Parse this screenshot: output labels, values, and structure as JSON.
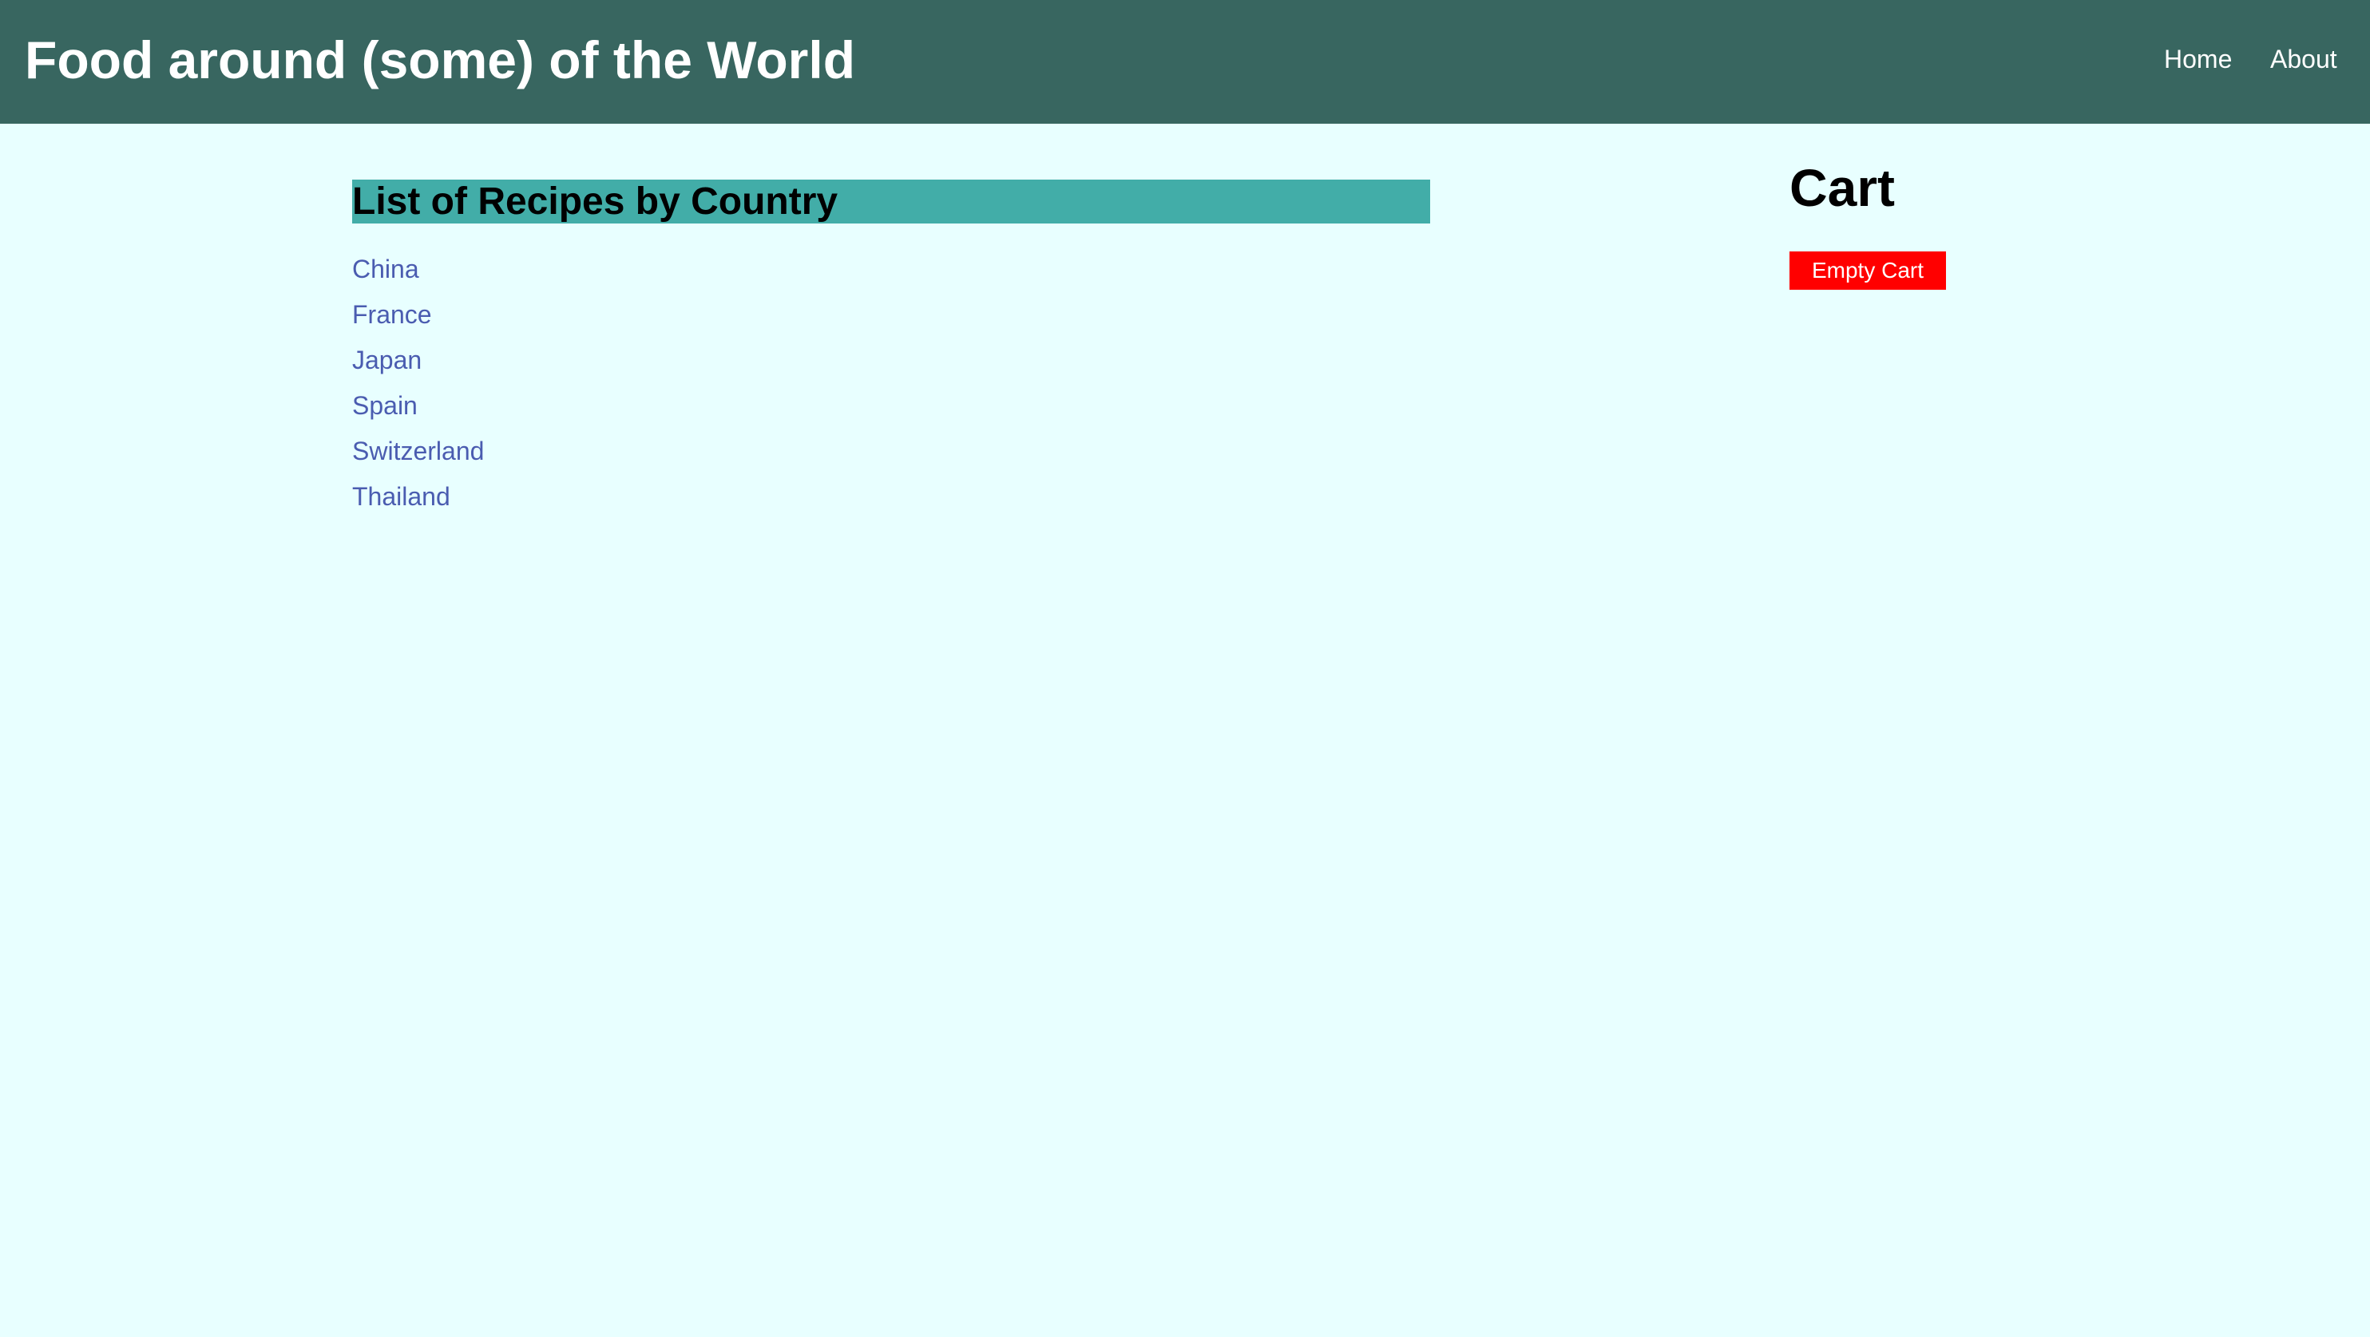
{
  "header": {
    "title": "Food around (some) of the World",
    "nav": {
      "home": "Home",
      "about": "About"
    }
  },
  "recipes": {
    "heading": "List of Recipes by Country",
    "countries": [
      "China",
      "France",
      "Japan",
      "Spain",
      "Switzerland",
      "Thailand"
    ]
  },
  "cart": {
    "title": "Cart",
    "empty_button": "Empty Cart"
  },
  "colors": {
    "header_bg": "#386660",
    "page_bg": "#e8ffff",
    "heading_bg": "#42ada8",
    "link": "#4a5cb0",
    "empty_cart_bg": "#ff0000"
  }
}
